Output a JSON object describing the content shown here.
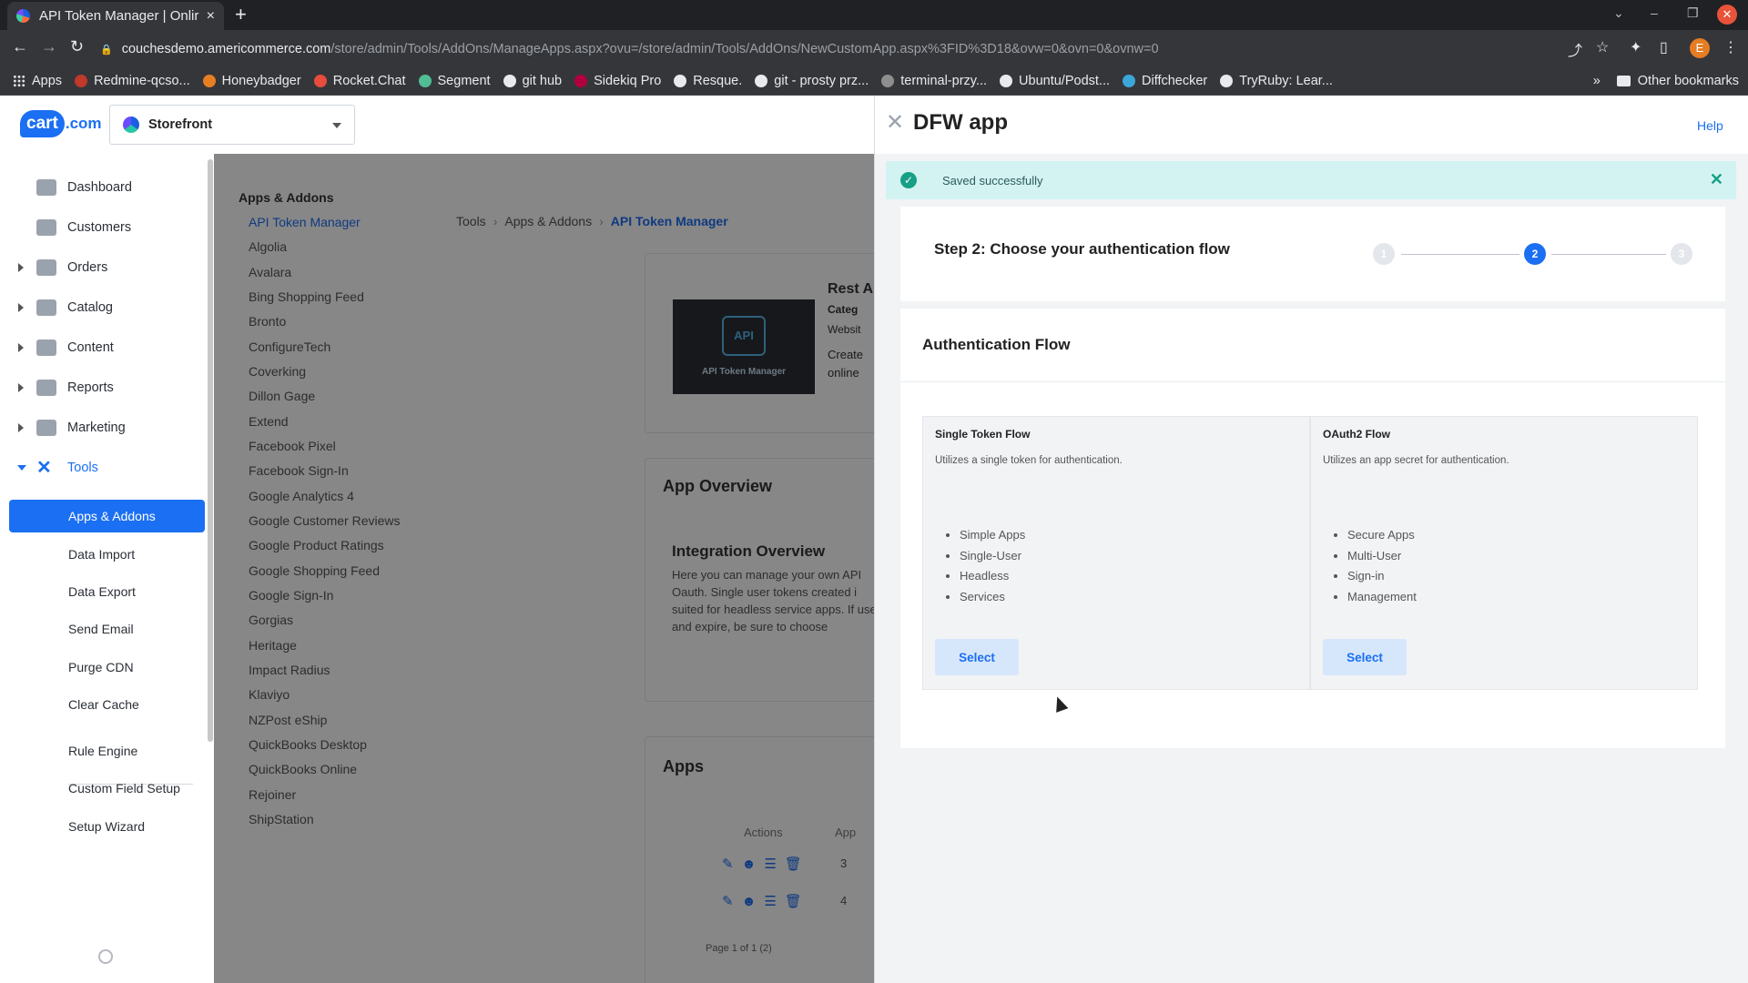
{
  "browser": {
    "tab_title": "API Token Manager | Onlir",
    "tab_close": "×",
    "new_tab": "+",
    "url_host": "couchesdemo.americommerce.com",
    "url_path": "/store/admin/Tools/AddOns/ManageApps.aspx?ovu=/store/admin/Tools/AddOns/NewCustomApp.aspx%3FID%3D18&ovw=0&ovn=0&ovnw=0",
    "bookmarks": [
      "Apps",
      "Redmine-qcso...",
      "Honeybadger",
      "Rocket.Chat",
      "Segment",
      "git hub",
      "Sidekiq Pro",
      "Resque.",
      "git - prosty prz...",
      "terminal-przy...",
      "Ubuntu/Podst...",
      "Diffchecker",
      "TryRuby: Lear..."
    ],
    "overflow": "»",
    "other_bookmarks": "Other bookmarks",
    "profile_initial": "E"
  },
  "header": {
    "logo_main": "cart",
    "logo_suffix": ".com",
    "store_name": "Storefront"
  },
  "sidebar": {
    "items": [
      "Dashboard",
      "Customers",
      "Orders",
      "Catalog",
      "Content",
      "Reports",
      "Marketing",
      "Tools"
    ],
    "tools_sub": [
      "Apps & Addons",
      "Data Import",
      "Data Export",
      "Send Email",
      "Purge CDN",
      "Clear Cache",
      "Rule Engine",
      "Custom Field Setup",
      "Setup Wizard"
    ]
  },
  "main": {
    "addons_title": "Apps & Addons",
    "addons": [
      "API Token Manager",
      "Algolia",
      "Avalara",
      "Bing Shopping Feed",
      "Bronto",
      "ConfigureTech",
      "Coverking",
      "Dillon Gage",
      "Extend",
      "Facebook Pixel",
      "Facebook Sign-In",
      "Google Analytics 4",
      "Google Customer Reviews",
      "Google Product Ratings",
      "Google Shopping Feed",
      "Google Sign-In",
      "Gorgias",
      "Heritage",
      "Impact Radius",
      "Klaviyo",
      "NZPost eShip",
      "QuickBooks Desktop",
      "QuickBooks Online",
      "Rejoiner",
      "ShipStation"
    ],
    "breadcrumb": [
      "Tools",
      "Apps & Addons",
      "API Token Manager"
    ],
    "app_card": {
      "thumb_chip": "API",
      "thumb_label": "API Token Manager",
      "name": "Rest A",
      "category": "Categ",
      "website": "Websit",
      "desc_1": "Create",
      "desc_2": "online"
    },
    "overview_title": "App Overview",
    "integration_title": "Integration Overview",
    "integration_text": "Here you can manage your own API Oauth. Single user tokens created i suited for headless service apps. If user and expire, be sure to choose",
    "apps_title": "Apps",
    "apps_columns": [
      "Actions",
      "App"
    ],
    "apps_rows": [
      "3",
      "4"
    ],
    "pager": "Page 1 of 1 (2)"
  },
  "panel": {
    "title": "DFW app",
    "help": "Help",
    "toast": "Saved successfully",
    "step_title": "Step 2: Choose your authentication flow",
    "steps": [
      "1",
      "2",
      "3"
    ],
    "current_step": 2,
    "auth_title": "Authentication Flow",
    "flows": [
      {
        "name": "Single Token Flow",
        "description": "Utilizes a single token for authentication.",
        "features": [
          "Simple Apps",
          "Single-User",
          "Headless",
          "Services"
        ],
        "button": "Select"
      },
      {
        "name": "OAuth2 Flow",
        "description": "Utilizes an app secret for authentication.",
        "features": [
          "Secure Apps",
          "Multi-User",
          "Sign-in",
          "Management"
        ],
        "button": "Select"
      }
    ]
  },
  "colors": {
    "accent": "#1b6ff2",
    "toast_bg": "#d3f3f3",
    "toast_icon": "#16a085"
  }
}
